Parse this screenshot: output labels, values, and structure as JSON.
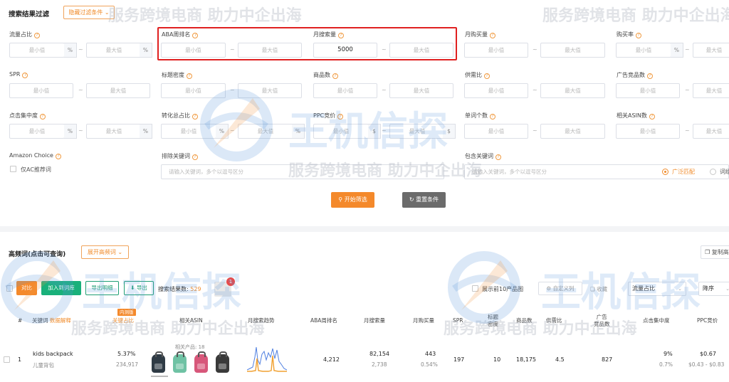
{
  "filter": {
    "title": "搜索结果过滤",
    "hide_button": "隐藏过滤条件",
    "min_ph": "最小值",
    "max_ph": "最大值",
    "percent": "%",
    "dollar": "$",
    "dash": "~",
    "labels": {
      "traffic_share": "流量占比",
      "aba_rank": "ABA周排名",
      "monthly_search": "月搜索量",
      "monthly_purchase": "月购买量",
      "purchase_rate": "购买率",
      "spr": "SPR",
      "title_density": "标题密度",
      "product_count": "商品数",
      "supply_ratio": "供需比",
      "ad_products": "广告竞品数",
      "click_concentration": "点击集中度",
      "conversion_share": "转化总占比",
      "ppc_bid": "PPC竞价",
      "word_count": "单词个数",
      "related_asin": "相关ASIN数",
      "amazon_choice": "Amazon Choice",
      "exclude_kw": "排除关键词",
      "include_kw": "包含关键词"
    },
    "monthly_search_min_value": "5000",
    "ac_only": "仅AC推荐词",
    "keyword_placeholder": "请输入关键词，多个以逗号区分",
    "broad_match": "广泛匹配",
    "phrase_match": "词组",
    "start_button": "开始筛选",
    "reset_button": "重置条件"
  },
  "hf": {
    "title": "高频词(点击可查询)",
    "expand_button": "展开高频词",
    "copy_button": "复制高",
    "compare": "对比",
    "add_kw": "加入到词库",
    "export_detail": "导出明细",
    "export": "导出",
    "result_label": "搜索结果数:",
    "result_count": "529",
    "trash_badge": "1",
    "show_top10": "展示前10产品图",
    "custom_columns": "自定义列",
    "collect": "收藏",
    "sort_by": "流量占比",
    "order": "降序"
  },
  "table": {
    "headers": {
      "hash": "#",
      "keyword": "关键词",
      "keyword_sub": "数据解释",
      "traffic_tag": "内测版",
      "traffic": "关键占比",
      "related_asin": "相关ASIN",
      "trend": "月搜索趋势",
      "aba": "ABA周排名",
      "monthly_search": "月搜索量",
      "monthly_purchase": "月购买量",
      "spr": "SPR",
      "title_density_1": "标题",
      "title_density_2": "密度",
      "products": "商品数",
      "supply_ratio": "供需比",
      "ad_1": "广告",
      "ad_2": "竞品数",
      "click_conc": "点击集中度",
      "ppc": "PPC竞价"
    },
    "rows": [
      {
        "index": "1",
        "keyword": "kids backpack",
        "keyword_cn": "儿童背包",
        "traffic_pct": "5.37%",
        "traffic_num": "234,917",
        "related_products": "相关产品: 18",
        "aba_rank": "4,212",
        "monthly_search": "82,154",
        "monthly_search_sub": "2,738",
        "monthly_purchase": "443",
        "purchase_rate": "0.54%",
        "spr": "197",
        "title_density": "10",
        "products": "18,175",
        "supply_ratio": "4.5",
        "ad_products": "827",
        "click_conc": "9%",
        "click_conc_sub": "0.7%",
        "ppc": "$0.67",
        "ppc_range": "$0.43 - $0.83"
      }
    ]
  },
  "watermark": {
    "slogan": "服务跨境电商 助力中企出海",
    "brand": "王机信探"
  },
  "colors": {
    "accent": "#f4892b",
    "green": "#19b07a",
    "red_box": "#e02020"
  }
}
